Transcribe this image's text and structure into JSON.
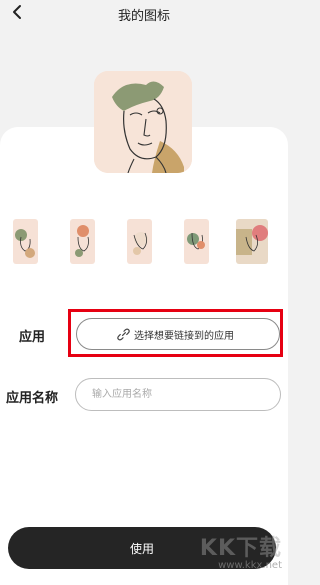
{
  "header": {
    "title": "我的图标",
    "back_icon": "chevron-left-icon"
  },
  "form": {
    "app_label": "应用",
    "app_link_text": "选择想要链接到的应用",
    "link_icon": "link-icon",
    "name_label": "应用名称",
    "name_placeholder": "输入应用名称",
    "name_value": ""
  },
  "actions": {
    "use_label": "使用"
  },
  "watermark": {
    "logo": "KK下载",
    "url": "www.kkx.net"
  },
  "colors": {
    "highlight": "#e60012",
    "button_bg": "#252525",
    "tile_bg": "#f6e1d6"
  }
}
